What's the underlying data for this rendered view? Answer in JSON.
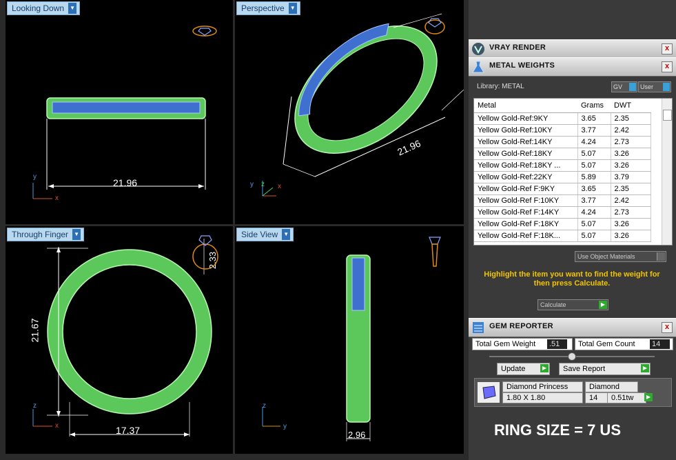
{
  "viewports": {
    "top_left": {
      "label": "Looking Down",
      "dimension": "21.96",
      "axis_v": "y",
      "axis_h": "x"
    },
    "top_right": {
      "label": "Perspective",
      "dimension": "21.96",
      "axis_v": "y",
      "axis_h": "x",
      "axis_d": "z"
    },
    "bottom_left": {
      "label": "Through Finger",
      "dim_bottom": "17.37",
      "dim_side": "21.67",
      "dim_gem": "2.33",
      "axis_v": "z",
      "axis_h": "x"
    },
    "bottom_right": {
      "label": "Side View",
      "dimension": "2.96",
      "axis_v": "z",
      "axis_h": "y"
    }
  },
  "panel": {
    "vray": {
      "title": "VRAY RENDER",
      "close": "x"
    },
    "metal": {
      "title": "METAL WEIGHTS",
      "close": "x",
      "library": "Library: METAL",
      "toggle_gv": "GV",
      "toggle_user": "User",
      "columns": [
        "Metal",
        "Grams",
        "DWT"
      ],
      "rows": [
        [
          "Yellow Gold-Ref:9KY",
          "3.65",
          "2.35"
        ],
        [
          "Yellow Gold-Ref:10KY",
          "3.77",
          "2.42"
        ],
        [
          "Yellow Gold-Ref:14KY",
          "4.24",
          "2.73"
        ],
        [
          "Yellow Gold-Ref:18KY",
          "5.07",
          "3.26"
        ],
        [
          "Yellow Gold-Ref:18KY ...",
          "5.07",
          "3.26"
        ],
        [
          "Yellow Gold-Ref:22KY",
          "5.89",
          "3.79"
        ],
        [
          "Yellow Gold-Ref F:9KY",
          "3.65",
          "2.35"
        ],
        [
          "Yellow Gold-Ref F:10KY",
          "3.77",
          "2.42"
        ],
        [
          "Yellow Gold-Ref F:14KY",
          "4.24",
          "2.73"
        ],
        [
          "Yellow Gold-Ref F:18KY",
          "5.07",
          "3.26"
        ],
        [
          "Yellow Gold-Ref F:18K...",
          "5.07",
          "3.26"
        ]
      ],
      "use_object_materials": "Use Object Materials",
      "hint": "Highlight the item you want to find the weight for then press Calculate.",
      "calculate": "Calculate"
    },
    "gem": {
      "title": "GEM REPORTER",
      "close": "x",
      "total_weight_label": "Total Gem Weight",
      "total_weight": ".51",
      "total_count_label": "Total Gem Count",
      "total_count": "14",
      "update": "Update",
      "save_report": "Save Report",
      "item": {
        "name": "Diamond Princess",
        "material": "Diamond",
        "size": "1.80 X 1.80",
        "count": "14",
        "weight": "0.51tw"
      }
    },
    "ring_size": "RING SIZE = 7 US"
  }
}
